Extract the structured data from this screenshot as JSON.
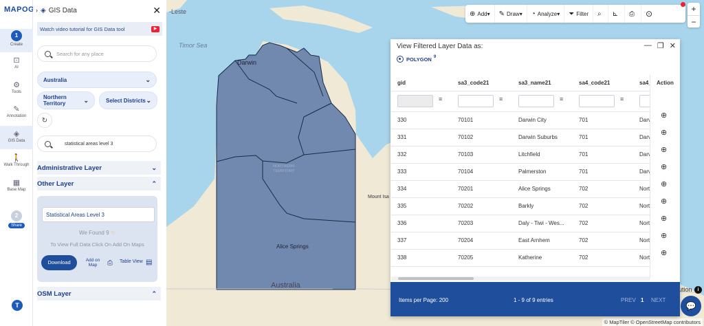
{
  "app": {
    "logo": "MAPOG",
    "panel_title": "GIS Data"
  },
  "rail": [
    {
      "step": "1",
      "label": "Create"
    },
    {
      "icon": "AI",
      "label": "AI"
    },
    {
      "icon": "tools",
      "label": "Tools"
    },
    {
      "icon": "annotation",
      "label": "Annotation"
    },
    {
      "icon": "gis",
      "label": "GIS Data"
    },
    {
      "icon": "walk",
      "label": "Walk Through"
    },
    {
      "icon": "basemap",
      "label": "Base Map"
    },
    {
      "step": "2",
      "label": "Share"
    }
  ],
  "help_label": "T",
  "panel": {
    "tutorial": "Watch video tutorial for GIS Data tool",
    "search_placeholder": "Search for any place",
    "country": "Australia",
    "state": "Northern Territory",
    "district": "Select Districts",
    "layer_search": "statistical areas level 3",
    "sections": {
      "admin": "Administrative Layer",
      "other": "Other Layer",
      "osm": "OSM Layer"
    },
    "card": {
      "layer_name": "Statistical Areas Level 3",
      "found": "We Found 9",
      "hint": "To View Full Data Click On Add On Maps",
      "download": "Download",
      "add_on_map": "Add on Map",
      "table_view": "Table View"
    }
  },
  "toolbar": {
    "add": "Add",
    "draw": "Draw",
    "analyze": "Analyze",
    "filter": "Filter"
  },
  "map_labels": {
    "timor_sea": "Timor Sea",
    "leste": "-Leste",
    "darwin": "Darwin",
    "northern_territory": "NORTHERN TERRITORY",
    "alice_springs": "Alice Springs",
    "australia": "Australia",
    "mount_isa": "Mount Isa",
    "ution": "ution",
    "attribution": "© MapTiler © OpenStreetMap contributors"
  },
  "data_window": {
    "title": "View Filtered Layer Data as:",
    "geometry": "POLYGON",
    "count": "9",
    "columns": [
      "gid",
      "sa3_code21",
      "sa3_name21",
      "sa4_code21",
      "sa4_"
    ],
    "action_header": "Action",
    "rows": [
      [
        "330",
        "70101",
        "Darwin City",
        "701",
        "Darv"
      ],
      [
        "331",
        "70102",
        "Darwin Suburbs",
        "701",
        "Darv"
      ],
      [
        "332",
        "70103",
        "Litchfield",
        "701",
        "Darv"
      ],
      [
        "333",
        "70104",
        "Palmerston",
        "701",
        "Darv"
      ],
      [
        "334",
        "70201",
        "Alice Springs",
        "702",
        "Nort"
      ],
      [
        "335",
        "70202",
        "Barkly",
        "702",
        "Nort"
      ],
      [
        "336",
        "70203",
        "Daly - Tiwi - Wes...",
        "702",
        "Nort"
      ],
      [
        "337",
        "70204",
        "East Arnhem",
        "702",
        "Nort"
      ],
      [
        "338",
        "70205",
        "Katherine",
        "702",
        "Nort"
      ]
    ],
    "footer": {
      "per_page": "Items per Page: 200",
      "entries": "1 - 9 of 9 entries",
      "prev": "PREV",
      "page": "1",
      "next": "NEXT"
    }
  },
  "colors": {
    "primary": "#1e4e9c",
    "water": "#a8d4ec",
    "land": "#efe9d6",
    "polygon": "#5a78a8"
  }
}
